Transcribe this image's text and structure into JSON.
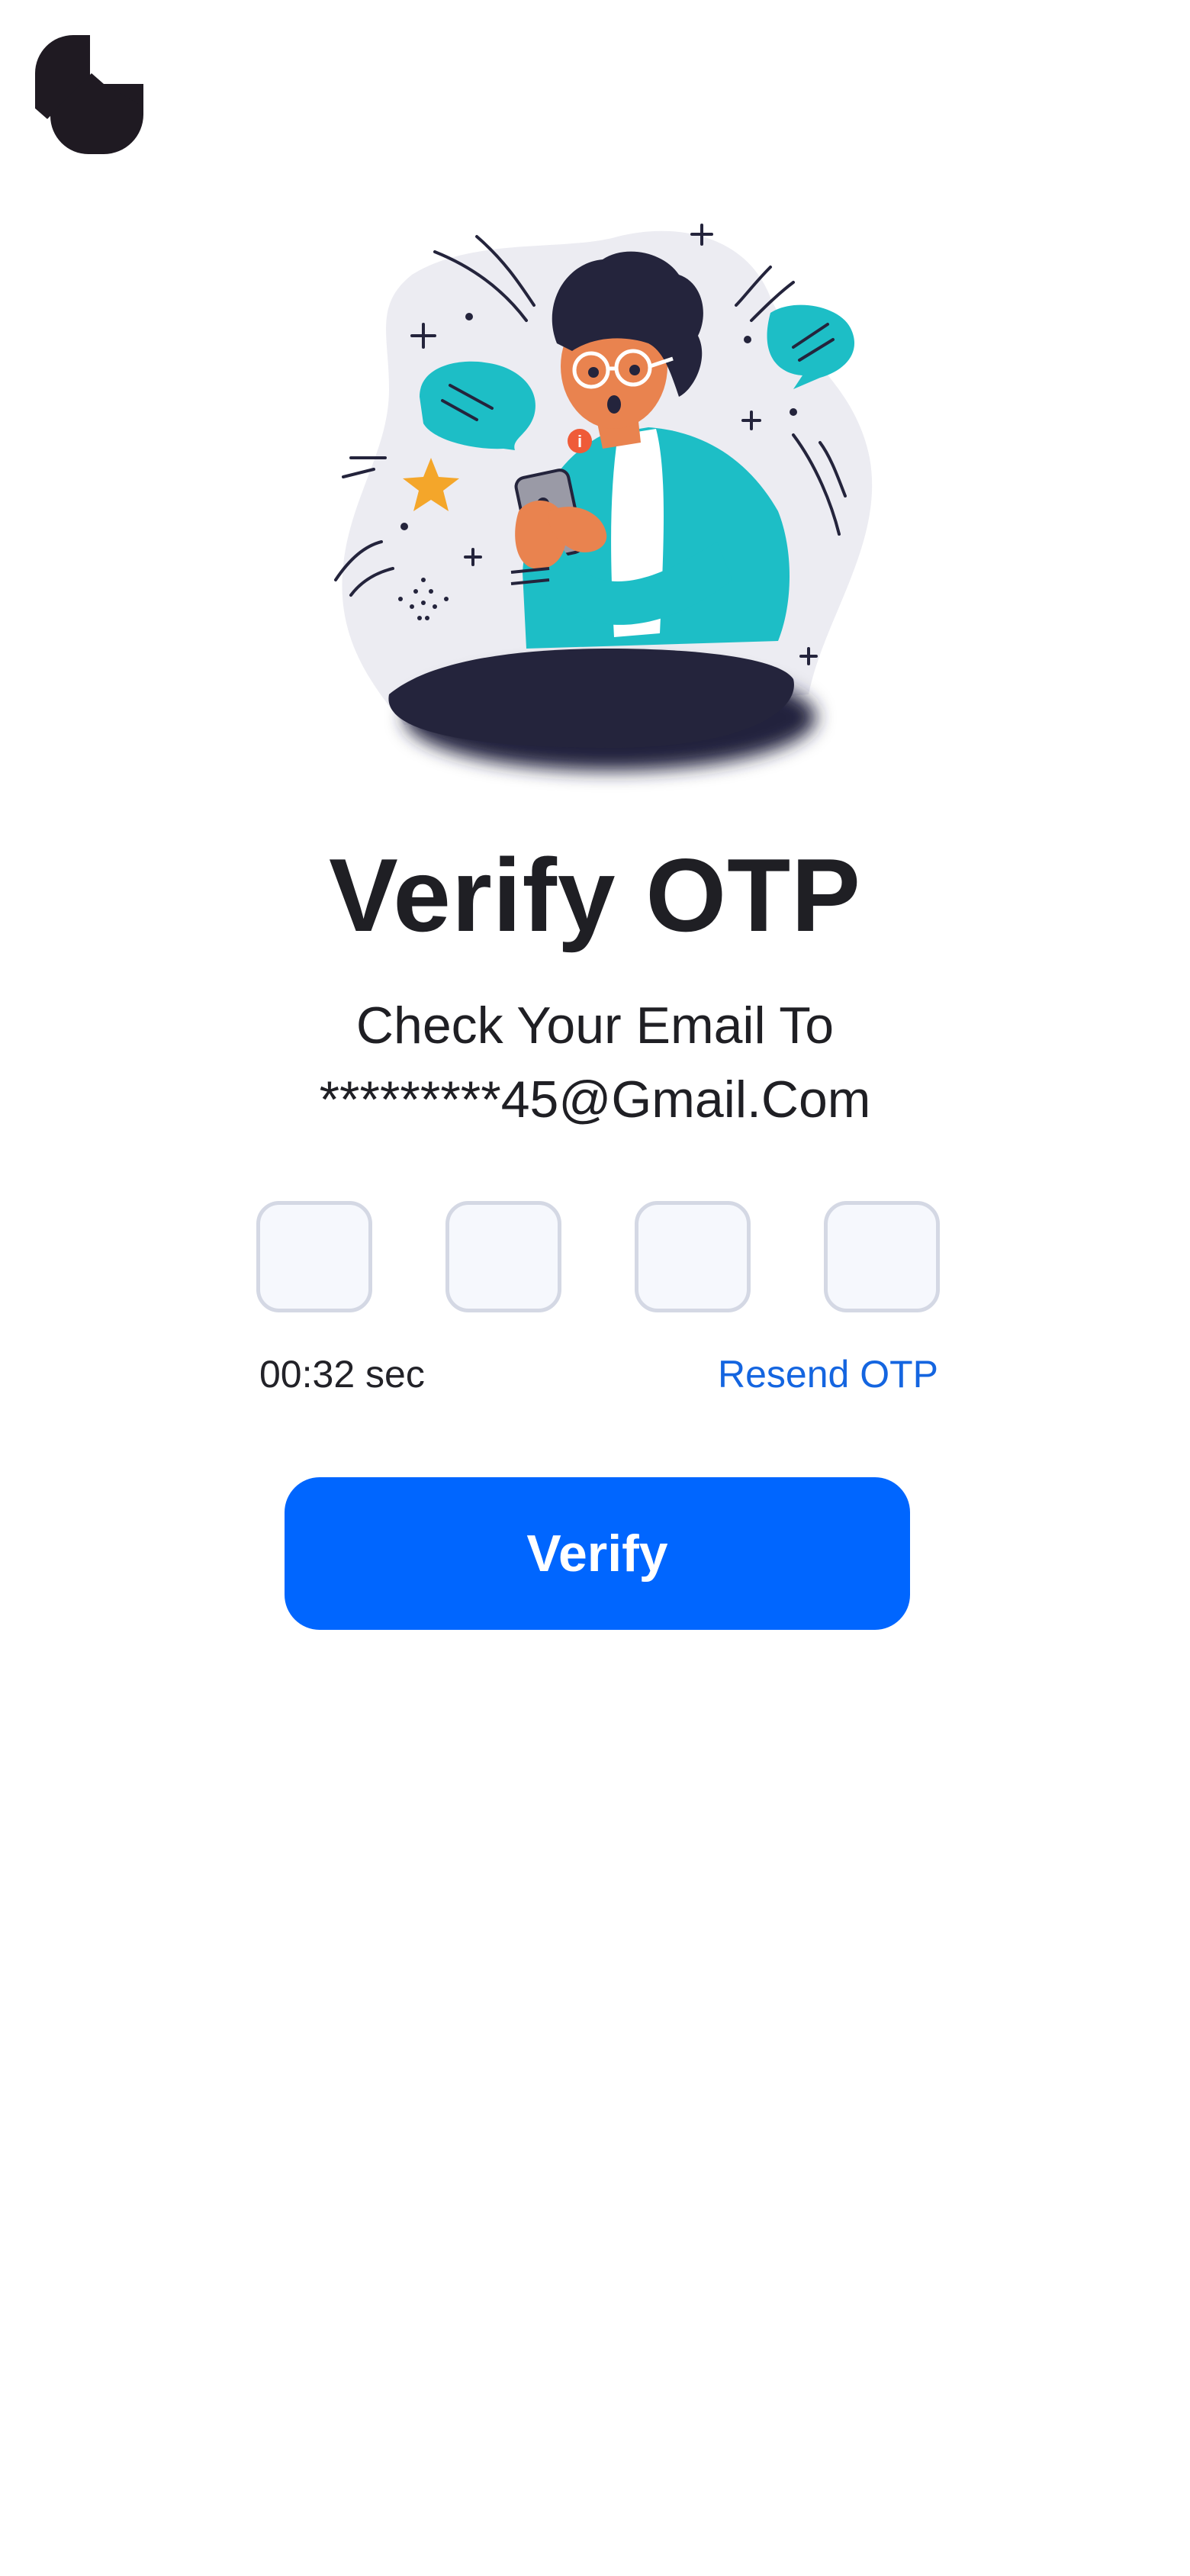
{
  "header": {
    "logo_icon": "brand-logo-icon"
  },
  "hero": {
    "illustration": "person-reading-phone-illustration",
    "colors": {
      "teal": "#1dbec6",
      "skin": "#e9834f",
      "hair": "#24243c",
      "star": "#f4a62a",
      "alert": "#ef5b38",
      "blob": "#ececf2"
    }
  },
  "main": {
    "title": "Verify OTP",
    "subtitle_line1": "Check Your Email To",
    "subtitle_line2": "*********45@Gmail.Com",
    "otp_boxes": [
      {
        "value": "",
        "placeholder": ""
      },
      {
        "value": "",
        "placeholder": ""
      },
      {
        "value": "",
        "placeholder": ""
      },
      {
        "value": "",
        "placeholder": ""
      }
    ],
    "timer": "00:32 sec",
    "resend_label": "Resend OTP",
    "verify_label": "Verify"
  },
  "theme": {
    "primary": "#0066ff",
    "link": "#1465e0",
    "text": "#1f1f24",
    "input_border": "#d4d8e4",
    "input_bg": "#f6f8fd"
  }
}
